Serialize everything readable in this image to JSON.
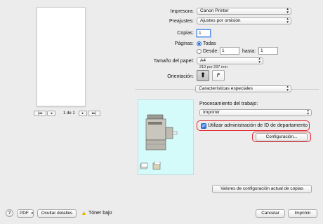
{
  "preview": {
    "page_indicator": "1 de 1"
  },
  "printer": {
    "label": "Impresora:",
    "value": "Canon Printer"
  },
  "presets": {
    "label": "Preajustes:",
    "value": "Ajustes por omisión"
  },
  "copies": {
    "label": "Copias:",
    "value": "1"
  },
  "pages": {
    "label": "Páginas:",
    "all_label": "Todas",
    "from_label": "Desde:",
    "from_value": "1",
    "to_label": "hasta:",
    "to_value": "1"
  },
  "paper_size": {
    "label": "Tamaño del papel:",
    "value": "A4",
    "dimensions": "210 por 297 mm"
  },
  "orientation": {
    "label": "Orientación:"
  },
  "section_select": {
    "value": "Características especiales"
  },
  "job_processing": {
    "label": "Procesamiento del trabajo:",
    "value": "Imprimir"
  },
  "department_id": {
    "checkbox_label": "Utilizar administración de ID de departamento",
    "checked": true
  },
  "configuration_button": "Configuración...",
  "current_settings_button": "Valores de configuración actual de copias",
  "footer": {
    "help": "?",
    "pdf": "PDF",
    "hide_details": "Ocultar detalles",
    "toner_warning": "Tóner bajo",
    "cancel": "Cancelar",
    "print": "Imprimir"
  },
  "colors": {
    "accent": "#2f6fd6",
    "highlight": "#e0262d",
    "preview_bg": "#d4fafa"
  }
}
